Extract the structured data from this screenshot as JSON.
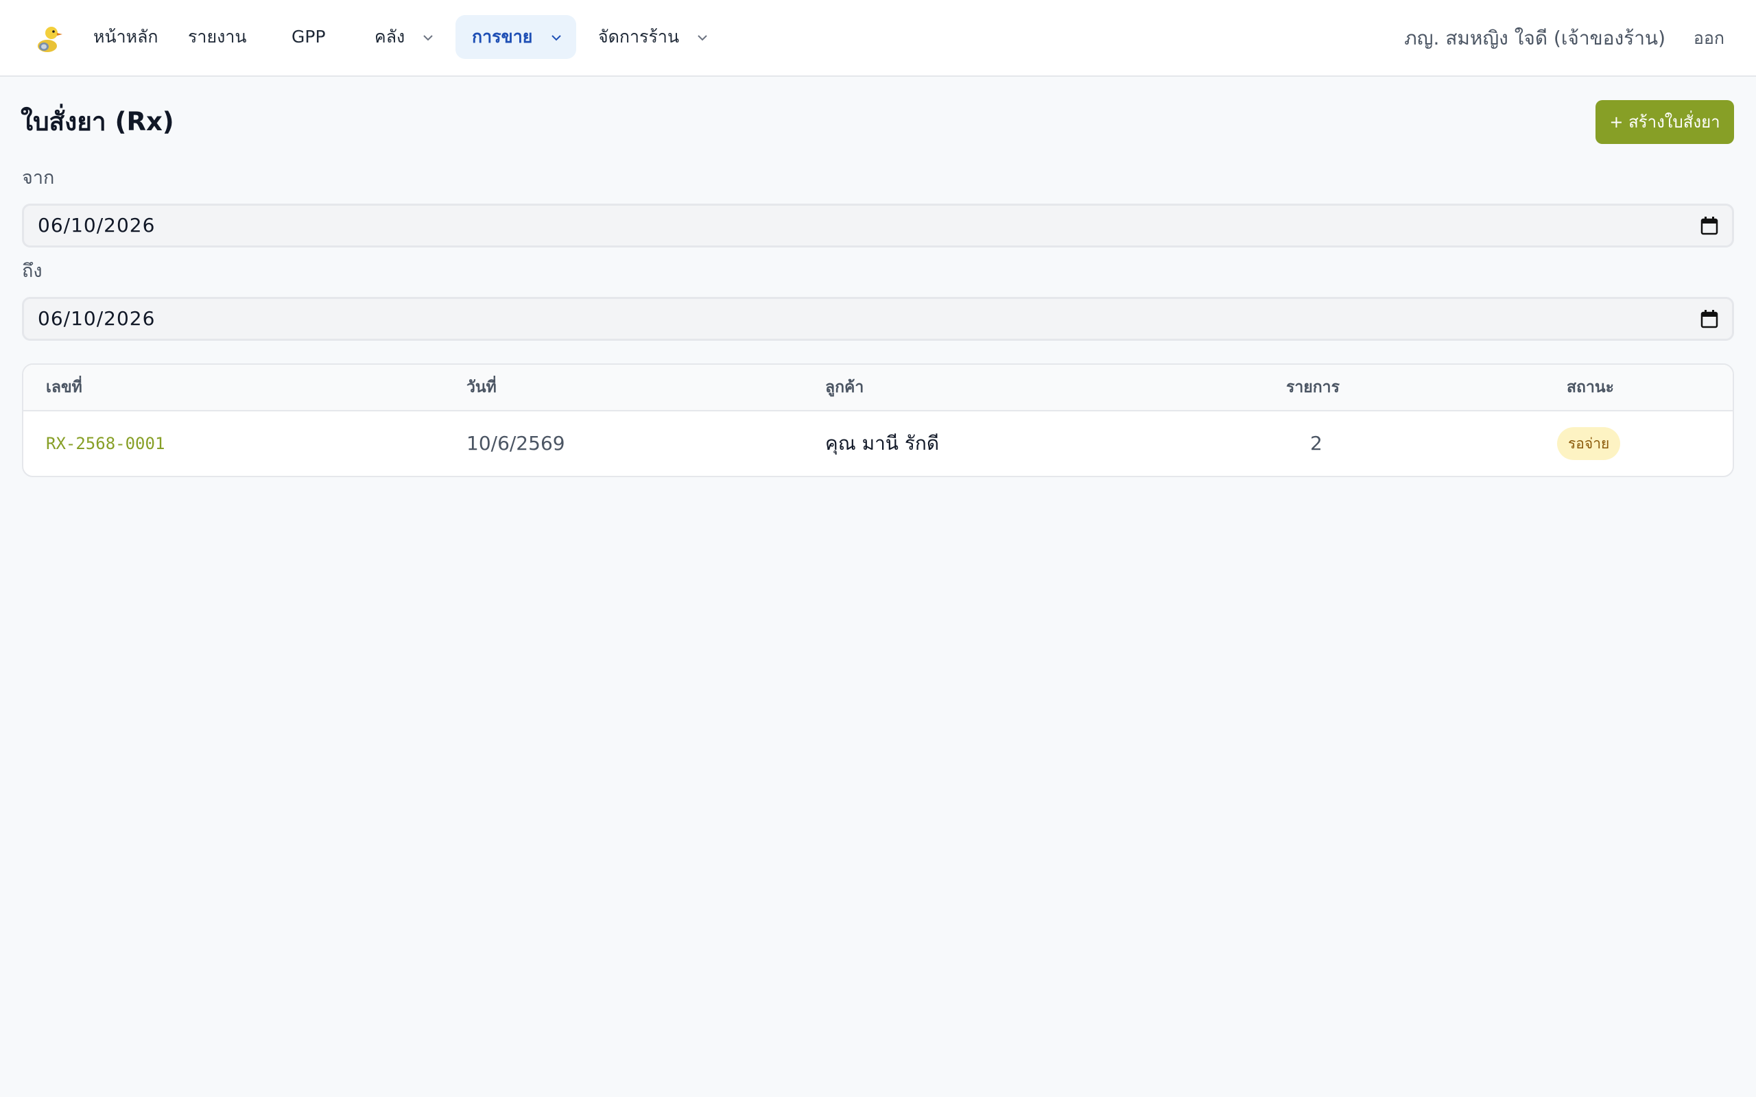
{
  "nav": {
    "items": [
      {
        "label": "หน้าหลัก"
      },
      {
        "label": "รายงาน"
      },
      {
        "label": "GPP"
      },
      {
        "label": "คลัง"
      },
      {
        "label": "การขาย"
      },
      {
        "label": "จัดการร้าน"
      }
    ],
    "active_item": "การขาย",
    "user_name": "ภญ. สมหญิง ใจดี (เจ้าของร้าน)",
    "logout_label": "ออก"
  },
  "page": {
    "title": "ใบสั่งยา (Rx)",
    "create_button_label": "+ สร้างใบสั่งยา"
  },
  "filters": {
    "from_label": "จาก",
    "from_value": "06/10/2026",
    "to_label": "ถึง",
    "to_value": "06/10/2026"
  },
  "table": {
    "columns": [
      "เลขที่",
      "วันที่",
      "ลูกค้า",
      "รายการ",
      "สถานะ"
    ],
    "rows": [
      {
        "number": "RX-2568-0001",
        "date": "10/6/2569",
        "customer": "คุณ มานี รักดี",
        "items": "2",
        "status": "รอจ่าย"
      }
    ]
  },
  "colors": {
    "accent": "#879f26",
    "active_nav_bg": "#eaf3fc",
    "active_nav_text": "#1e4fb5",
    "status_pending_bg": "#fdf3c3",
    "status_pending_text": "#8a5a0a"
  },
  "icons": [
    "duck-logo-icon",
    "chevron-down-icon",
    "calendar-icon"
  ]
}
